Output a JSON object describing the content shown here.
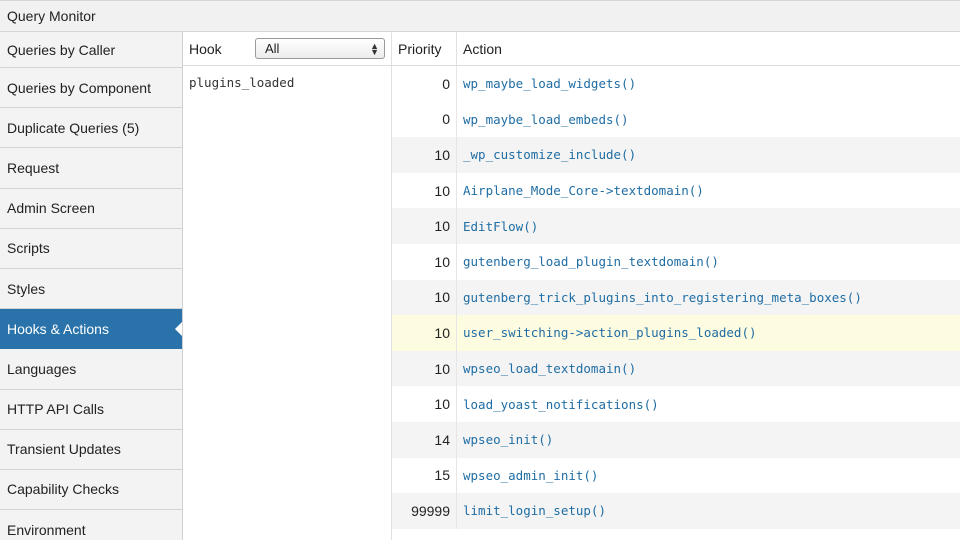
{
  "panel": {
    "title": "Query Monitor"
  },
  "sidebar": {
    "items": [
      {
        "label": "Queries by Caller"
      },
      {
        "label": "Queries by Component"
      },
      {
        "label": "Duplicate Queries (5)"
      },
      {
        "label": "Request"
      },
      {
        "label": "Admin Screen"
      },
      {
        "label": "Scripts"
      },
      {
        "label": "Styles"
      },
      {
        "label": "Hooks & Actions"
      },
      {
        "label": "Languages"
      },
      {
        "label": "HTTP API Calls"
      },
      {
        "label": "Transient Updates"
      },
      {
        "label": "Capability Checks"
      },
      {
        "label": "Environment"
      }
    ],
    "active_index": 7
  },
  "table": {
    "headers": {
      "hook": "Hook",
      "priority": "Priority",
      "action": "Action"
    },
    "filter": {
      "selected": "All"
    },
    "hook_name": "plugins_loaded",
    "rows": [
      {
        "priority": "0",
        "action": "wp_maybe_load_widgets()"
      },
      {
        "priority": "0",
        "action": "wp_maybe_load_embeds()"
      },
      {
        "priority": "10",
        "action": "_wp_customize_include()"
      },
      {
        "priority": "10",
        "action": "Airplane_Mode_Core->textdomain()"
      },
      {
        "priority": "10",
        "action": "EditFlow()"
      },
      {
        "priority": "10",
        "action": "gutenberg_load_plugin_textdomain()"
      },
      {
        "priority": "10",
        "action": "gutenberg_trick_plugins_into_registering_meta_boxes()"
      },
      {
        "priority": "10",
        "action": "user_switching->action_plugins_loaded()"
      },
      {
        "priority": "10",
        "action": "wpseo_load_textdomain()"
      },
      {
        "priority": "10",
        "action": "load_yoast_notifications()"
      },
      {
        "priority": "14",
        "action": "wpseo_init()"
      },
      {
        "priority": "15",
        "action": "wpseo_admin_init()"
      },
      {
        "priority": "99999",
        "action": "limit_login_setup()"
      }
    ]
  },
  "colors": {
    "active_nav": "#2a73aa",
    "link": "#1f6da4",
    "highlight_row": "#fdfbe0",
    "alt_row": "#f4f4f4"
  }
}
